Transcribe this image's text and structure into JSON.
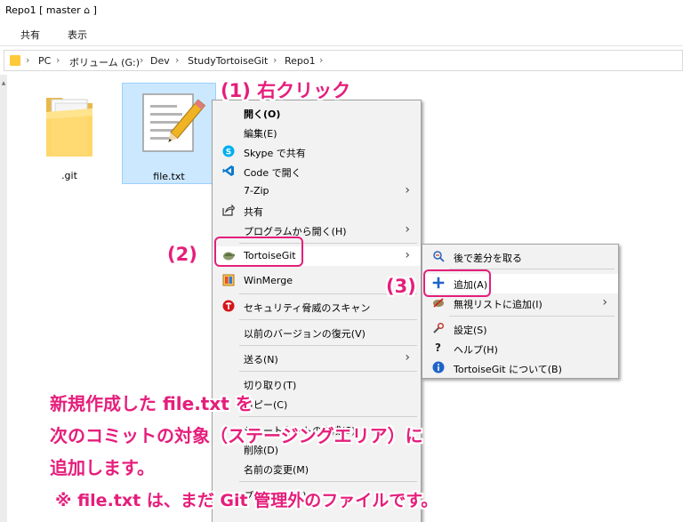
{
  "window": {
    "title": "Repo1 [ master ⌂ ]"
  },
  "ribbon": {
    "tabs": [
      "共有",
      "表示"
    ]
  },
  "address": {
    "crumbs": [
      "PC",
      "ボリューム (G:)",
      "Dev",
      "StudyTortoiseGit",
      "Repo1"
    ],
    "separator": "›"
  },
  "files": [
    {
      "name": ".git",
      "icon": "folder-icon"
    },
    {
      "name": "file.txt",
      "icon": "text-file-icon",
      "selected": true
    }
  ],
  "context_menu": {
    "items": [
      {
        "label": "開く(O)",
        "bold": true
      },
      {
        "label": "編集(E)"
      },
      {
        "label": "Skype で共有",
        "icon": "skype-icon"
      },
      {
        "label": "Code で開く",
        "icon": "vscode-icon"
      },
      {
        "label": "7-Zip",
        "submenu": true
      },
      {
        "label": "共有",
        "icon": "share-icon"
      },
      {
        "label": "プログラムから開く(H)",
        "submenu": true
      },
      {
        "label": "TortoiseGit",
        "icon": "tortoisegit-icon",
        "submenu": true,
        "highlighted": true
      },
      {
        "label": "WinMerge",
        "icon": "winmerge-icon"
      },
      {
        "label": "セキュリティ脅威のスキャン",
        "icon": "trendmicro-icon"
      },
      {
        "label": "以前のバージョンの復元(V)"
      },
      {
        "label": "送る(N)",
        "submenu": true
      },
      {
        "label": "切り取り(T)"
      },
      {
        "label": "コピー(C)"
      },
      {
        "label": "ショートカットの作成(S)"
      },
      {
        "label": "削除(D)"
      },
      {
        "label": "名前の変更(M)"
      },
      {
        "label": "プロパティ(R)"
      }
    ]
  },
  "submenu": {
    "items": [
      {
        "label": "後で差分を取る",
        "icon": "diff-later-icon"
      },
      {
        "label": "追加(A)",
        "icon": "plus-icon",
        "highlighted": true
      },
      {
        "label": "無視リストに追加(I)",
        "icon": "ignore-icon",
        "submenu": true
      },
      {
        "label": "設定(S)",
        "icon": "settings-icon"
      },
      {
        "label": "ヘルプ(H)",
        "icon": "help-icon"
      },
      {
        "label": "TortoiseGit について(B)",
        "icon": "info-icon"
      }
    ]
  },
  "annotations": {
    "step1": "(1) 右クリック",
    "step2": "(2)",
    "step3": "(3)",
    "description_lines": [
      "新規作成した file.txt を",
      "次のコミットの対象（ステージングエリア）に",
      "追加します。"
    ],
    "note": "※ file.txt は、まだ Git 管理外のファイルです。",
    "accent_color": "#e51e7b"
  }
}
